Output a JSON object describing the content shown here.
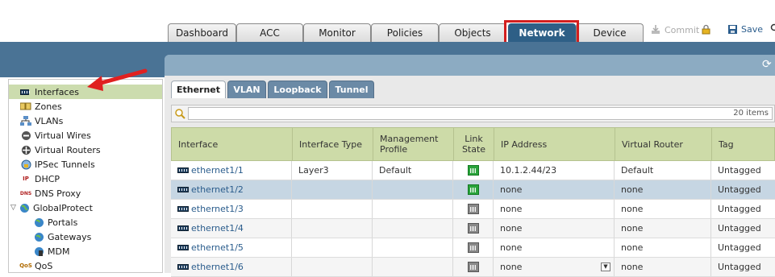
{
  "top_tabs": [
    "Dashboard",
    "ACC",
    "Monitor",
    "Policies",
    "Objects",
    "Network",
    "Device"
  ],
  "active_tab": "Network",
  "toolbar": {
    "commit_label": "Commit",
    "save_label": "Save"
  },
  "sidebar": {
    "items": [
      {
        "label": "Interfaces",
        "icon": "interfaces-icon",
        "selected": true
      },
      {
        "label": "Zones",
        "icon": "zones-icon"
      },
      {
        "label": "VLANs",
        "icon": "vlans-icon"
      },
      {
        "label": "Virtual Wires",
        "icon": "virtual-wires-icon"
      },
      {
        "label": "Virtual Routers",
        "icon": "virtual-routers-icon"
      },
      {
        "label": "IPSec Tunnels",
        "icon": "ipsec-tunnels-icon"
      },
      {
        "label": "DHCP",
        "icon": "dhcp-icon"
      },
      {
        "label": "DNS Proxy",
        "icon": "dns-proxy-icon"
      },
      {
        "label": "GlobalProtect",
        "icon": "globalprotect-icon",
        "expanded": true
      },
      {
        "label": "Portals",
        "icon": "portals-icon",
        "child": true
      },
      {
        "label": "Gateways",
        "icon": "gateways-icon",
        "child": true
      },
      {
        "label": "MDM",
        "icon": "mdm-icon",
        "child": true
      },
      {
        "label": "QoS",
        "icon": "qos-icon"
      }
    ]
  },
  "subtabs": [
    "Ethernet",
    "VLAN",
    "Loopback",
    "Tunnel"
  ],
  "active_subtab": "Ethernet",
  "search": {
    "count_label": "20 items"
  },
  "table": {
    "columns": [
      "Interface",
      "Interface Type",
      "Management Profile",
      "Link State",
      "IP Address",
      "Virtual Router",
      "Tag"
    ],
    "rows": [
      {
        "interface": "ethernet1/1",
        "type": "Layer3",
        "profile": "Default",
        "link": "up",
        "ip": "10.1.2.44/23",
        "router": "Default",
        "tag": "Untagged"
      },
      {
        "interface": "ethernet1/2",
        "type": "",
        "profile": "",
        "link": "up",
        "ip": "none",
        "router": "none",
        "tag": "Untagged",
        "selected": true
      },
      {
        "interface": "ethernet1/3",
        "type": "",
        "profile": "",
        "link": "down",
        "ip": "none",
        "router": "none",
        "tag": "Untagged"
      },
      {
        "interface": "ethernet1/4",
        "type": "",
        "profile": "",
        "link": "down",
        "ip": "none",
        "router": "none",
        "tag": "Untagged"
      },
      {
        "interface": "ethernet1/5",
        "type": "",
        "profile": "",
        "link": "down",
        "ip": "none",
        "router": "none",
        "tag": "Untagged"
      },
      {
        "interface": "ethernet1/6",
        "type": "",
        "profile": "",
        "link": "down",
        "ip": "none",
        "router": "none",
        "tag": "Untagged"
      }
    ]
  },
  "colors": {
    "band": "#4a7395",
    "active_tab": "#2e5f86",
    "highlight": "#d31f1f",
    "header": "#cddba8",
    "link_up": "#2aa33b"
  }
}
